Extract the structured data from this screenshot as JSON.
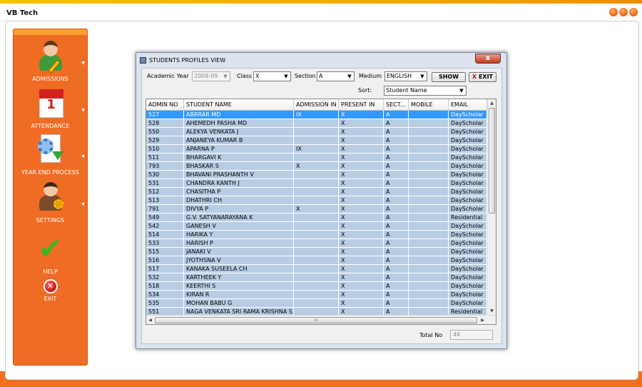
{
  "app": {
    "title": "VB Tech"
  },
  "sidebar": {
    "items": [
      {
        "label": "ADMISSIONS",
        "icon": "admissions-person-icon"
      },
      {
        "label": "ATTENDANCE",
        "icon": "calendar-icon",
        "calendar_day": "1"
      },
      {
        "label": "YEAR END PROCESS",
        "icon": "gear-document-icon"
      },
      {
        "label": "SETTINGS",
        "icon": "settings-person-icon"
      },
      {
        "label": "HELP",
        "icon": "checkmark-icon"
      },
      {
        "label": "EXIT",
        "icon": "exit-icon"
      }
    ],
    "caret_glyph": "▼"
  },
  "dialog": {
    "title": "STUDENTS PROFILES  VIEW",
    "close_glyph": "x",
    "filters": {
      "academic_year_label": "Academic Year",
      "academic_year_value": "2008-09",
      "class_label": "Class",
      "class_value": "X",
      "section_label": "Section",
      "section_value": "A",
      "medium_label": "Medium",
      "medium_value": "ENGLISH",
      "sort_label": "Sort:",
      "sort_value": "Student Name",
      "show_button": "SHOW",
      "exit_button": "EXIT",
      "exit_x": "X"
    },
    "grid": {
      "columns": [
        "ADMIN NO",
        "STUDENT NAME",
        "ADMISSION IN",
        "PRESENT IN",
        "SECT...",
        "MOBILE",
        "EMAIL"
      ],
      "rows": [
        [
          "527",
          "ABRRAR MD",
          "IX",
          "X",
          "A",
          "",
          "DayScholar"
        ],
        [
          "528",
          "AHEMEDH PASHA MD",
          "",
          "X",
          "A",
          "",
          "DayScholar"
        ],
        [
          "550",
          "ALEKYA VENKATA J",
          "",
          "X",
          "A",
          "",
          "DayScholar"
        ],
        [
          "529",
          "ANJANEYA KUMAR B",
          "",
          "X",
          "A",
          "",
          "DayScholar"
        ],
        [
          "510",
          "APARNA P",
          "IX",
          "X",
          "A",
          "",
          "DayScholar"
        ],
        [
          "511",
          "BHARGAVI K",
          "",
          "X",
          "A",
          "",
          "DayScholar"
        ],
        [
          "793",
          "BHASKAR S",
          "X",
          "X",
          "A",
          "",
          "DayScholar"
        ],
        [
          "530",
          "BHAVANI PRASHANTH V",
          "",
          "X",
          "A",
          "",
          "DayScholar"
        ],
        [
          "531",
          "CHANDRA KANTH J",
          "",
          "X",
          "A",
          "",
          "DayScholar"
        ],
        [
          "512",
          "CHASITHA P",
          "",
          "X",
          "A",
          "",
          "DayScholar"
        ],
        [
          "513",
          "DHATHRI CH",
          "",
          "X",
          "A",
          "",
          "DayScholar"
        ],
        [
          "791",
          "DIVYA   P",
          "X",
          "X",
          "A",
          "",
          "DayScholar"
        ],
        [
          "549",
          "G.V. SATYANARAYANA K",
          "",
          "X",
          "A",
          "",
          "Residential"
        ],
        [
          "542",
          "GANESH V",
          "",
          "X",
          "A",
          "",
          "DayScholar"
        ],
        [
          "514",
          "HARIKA Y",
          "",
          "X",
          "A",
          "",
          "DayScholar"
        ],
        [
          "533",
          "HARISH P",
          "",
          "X",
          "A",
          "",
          "DayScholar"
        ],
        [
          "515",
          "JANAKI V",
          "",
          "X",
          "A",
          "",
          "DayScholar"
        ],
        [
          "516",
          "JYOTHSNA V",
          "",
          "X",
          "A",
          "",
          "DayScholar"
        ],
        [
          "517",
          "KANAKA SUSEELA CH",
          "",
          "X",
          "A",
          "",
          "DayScholar"
        ],
        [
          "532",
          "KARTHEEK Y",
          "",
          "X",
          "A",
          "",
          "DayScholar"
        ],
        [
          "518",
          "KEERTHI S",
          "",
          "X",
          "A",
          "",
          "DayScholar"
        ],
        [
          "534",
          "KIRAN R",
          "",
          "X",
          "A",
          "",
          "DayScholar"
        ],
        [
          "535",
          "MOHAN BABU G",
          "",
          "X",
          "A",
          "",
          "DayScholar"
        ],
        [
          "551",
          "NAGA VENKATA SRI RAMA KRISHNA S...",
          "",
          "X",
          "A",
          "",
          "Residential"
        ]
      ],
      "selected_row": 0
    },
    "total_label": "Total No",
    "total_value": "46"
  },
  "colors": {
    "sidebar": "#ef6c25",
    "row": "#b8cce4",
    "row_selected": "#3399ff"
  }
}
